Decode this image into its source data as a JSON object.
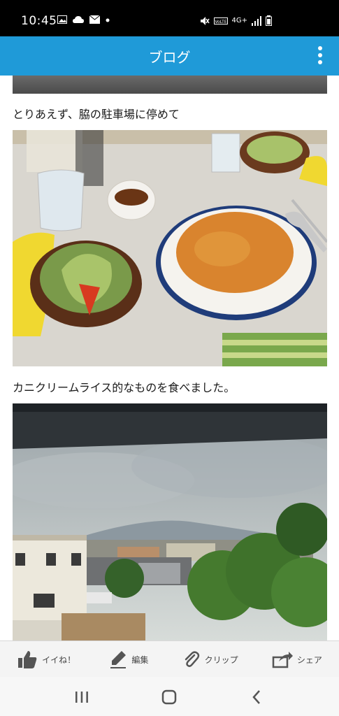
{
  "status_bar": {
    "time": "10:45",
    "left_icons": [
      "gallery-icon",
      "cloud-icon",
      "mail-icon",
      "dot-icon"
    ],
    "right_icons": [
      "mute-icon",
      "volte-icon",
      "4g-icon",
      "signal-icon",
      "battery-icon"
    ],
    "network_label": "4G+"
  },
  "app_bar": {
    "title": "ブログ",
    "color": "#1f9ad8"
  },
  "post": {
    "caption_1": "とりあえず、脇の駐車場に停めて",
    "caption_2": "カニクリームライス的なものを食べました。"
  },
  "toolbar": {
    "like_label": "イイね！",
    "edit_label": "編集",
    "clip_label": "クリップ",
    "share_label": "シェア"
  }
}
